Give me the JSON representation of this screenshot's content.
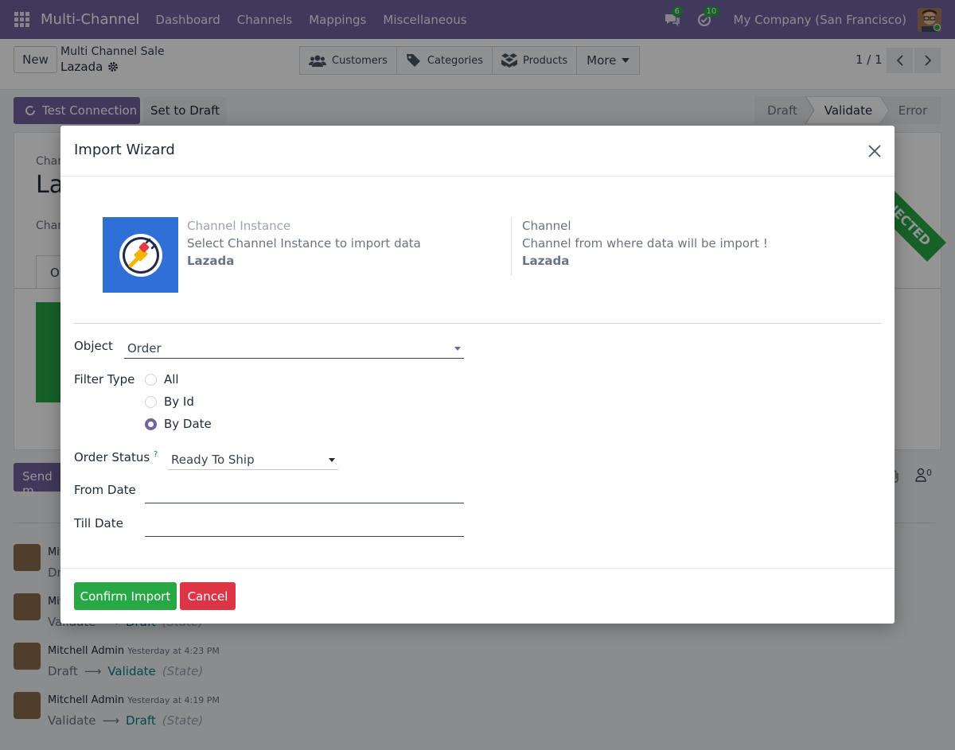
{
  "navbar": {
    "brand": "Multi-Channel",
    "menu": [
      "Dashboard",
      "Channels",
      "Mappings",
      "Miscellaneous"
    ],
    "messages_count": "6",
    "activities_count": "10",
    "company": "My Company (San Francisco)"
  },
  "control_panel": {
    "new_label": "New",
    "breadcrumb_parent": "Multi Channel Sale",
    "breadcrumb_current": "Lazada",
    "smart_buttons": [
      "Customers",
      "Categories",
      "Products"
    ],
    "more_label": "More",
    "pager": "1 / 1"
  },
  "form_header": {
    "test_connection_label": "Test Connection",
    "set_to_draft_label": "Set to Draft",
    "stages": [
      "Draft",
      "Validate",
      "Error"
    ],
    "active_stage": "Validate"
  },
  "background_sheet": {
    "label_1": "Chan",
    "title": "La",
    "label_2": "Chan",
    "tab": "Op",
    "ribbon": "CONNECTED",
    "send_message_label": "Send m",
    "followers_count": "0"
  },
  "chatter": [
    {
      "author": "Mit",
      "time": "",
      "from": "Dr",
      "to": "",
      "field": ""
    },
    {
      "author": "Mit",
      "time": "",
      "from": "Validate",
      "to": "Draft",
      "field": "(State)"
    },
    {
      "author": "Mitchell Admin",
      "time": "Yesterday at 4:23 PM",
      "from": "Draft",
      "to": "Validate",
      "field": "(State)"
    },
    {
      "author": "Mitchell Admin",
      "time": "Yesterday at 4:19 PM",
      "from": "Validate",
      "to": "Draft",
      "field": "(State)"
    }
  ],
  "modal": {
    "title": "Import Wizard",
    "channel_instance_label": "Channel Instance",
    "channel_instance_help": "Select Channel Instance to import data",
    "channel_instance_value": "Lazada",
    "channel_label": "Channel",
    "channel_help": "Channel from where data will be import !",
    "channel_value": "Lazada",
    "object_label": "Object",
    "object_value": "Order",
    "filter_type_label": "Filter Type",
    "filter_options": [
      "All",
      "By Id",
      "By Date"
    ],
    "filter_selected": "By Date",
    "order_status_label": "Order Status",
    "order_status_help_mark": "?",
    "order_status_value": "Ready To Ship",
    "from_date_label": "From Date",
    "till_date_label": "Till Date",
    "confirm_label": "Confirm Import",
    "cancel_label": "Cancel"
  },
  "colors": {
    "brand": "#71639e",
    "success": "#28a745",
    "danger": "#dc3545",
    "link": "#017e84"
  }
}
